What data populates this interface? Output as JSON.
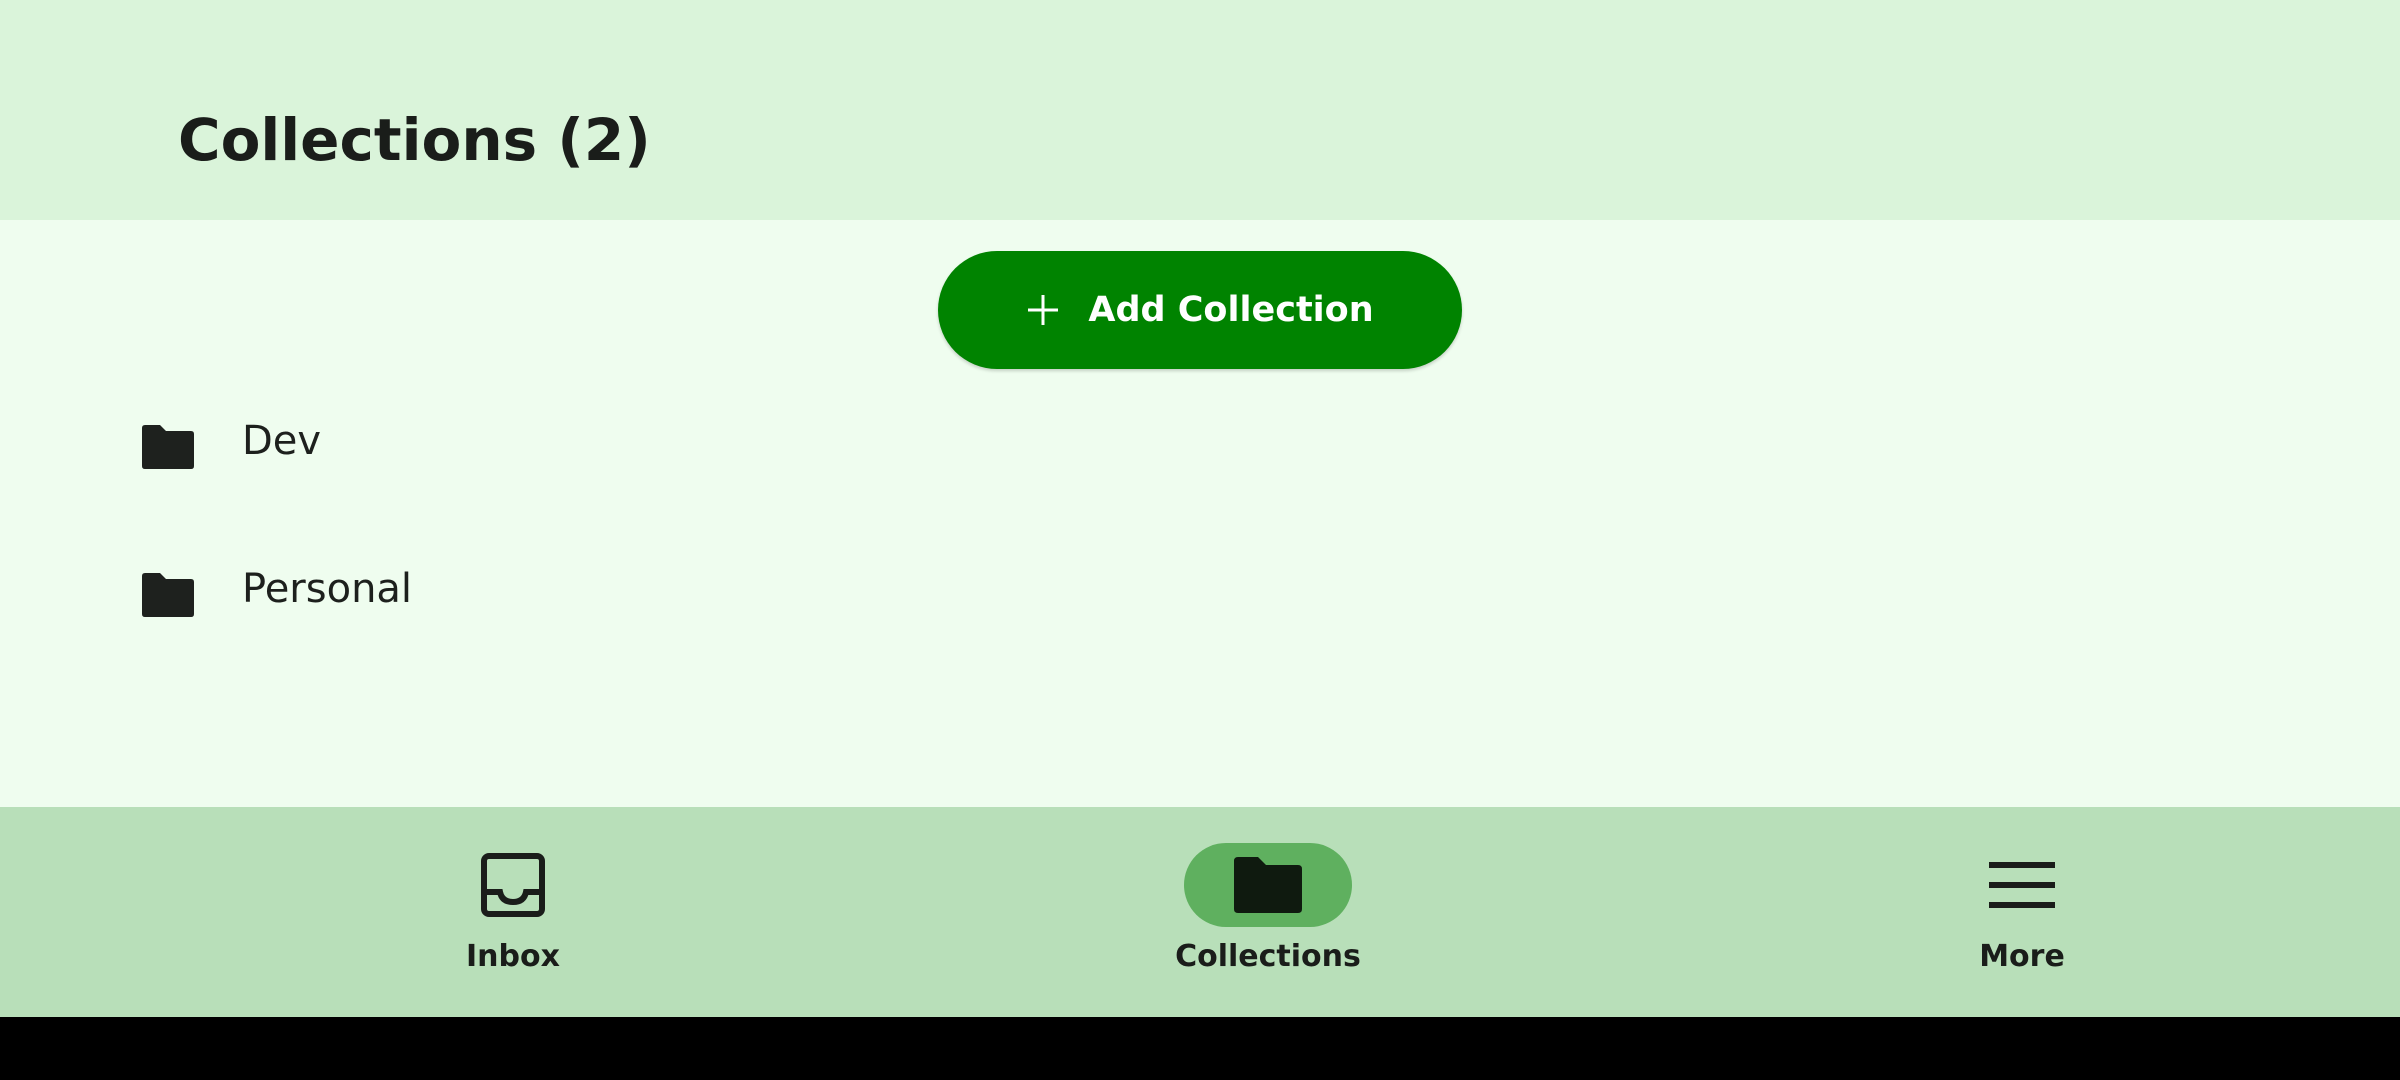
{
  "header": {
    "title": "Collections (2)"
  },
  "add_button": {
    "label": "Add Collection",
    "icon": "plus-icon"
  },
  "collections": [
    {
      "label": "Dev",
      "icon": "folder-icon"
    },
    {
      "label": "Personal",
      "icon": "folder-icon"
    }
  ],
  "bottom_nav": {
    "items": [
      {
        "label": "Inbox",
        "icon": "inbox-icon",
        "active": false
      },
      {
        "label": "Collections",
        "icon": "folder-icon",
        "active": true
      },
      {
        "label": "More",
        "icon": "menu-icon",
        "active": false
      }
    ]
  },
  "colors": {
    "header_bg": "#daf4da",
    "content_bg": "#effdef",
    "accent": "#008300",
    "nav_bg": "#b8dfb9",
    "nav_active_pill": "#5fb05f"
  }
}
